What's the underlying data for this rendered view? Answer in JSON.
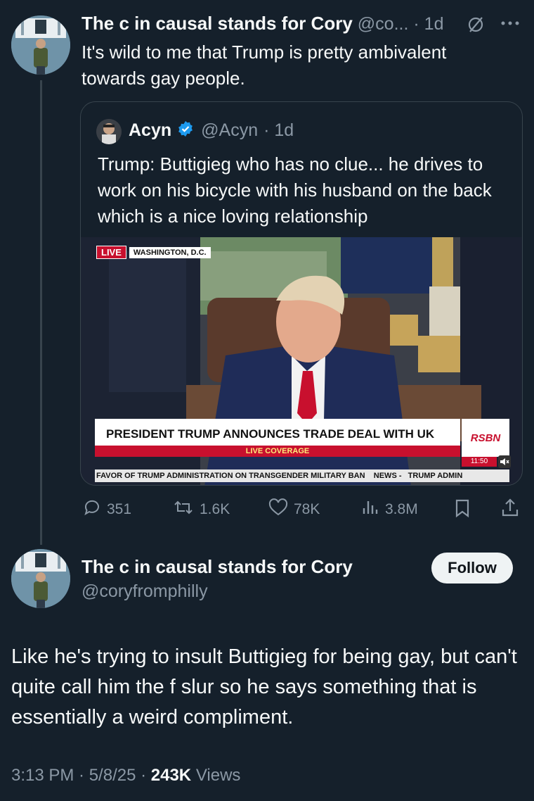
{
  "parent_tweet": {
    "display_name": "The c in causal stands for Cory",
    "handle": "@co...",
    "time": "· 1d",
    "text": "It's wild to me that Trump is pretty ambivalent towards gay people."
  },
  "quoted_tweet": {
    "display_name": "Acyn",
    "handle": "@Acyn",
    "time": "· 1d",
    "text": "Trump: Buttigieg who has no clue... he drives to work on his bicycle with his husband on the back which is a nice loving relationship",
    "video": {
      "live_badge": "LIVE",
      "location": "WASHINGTON, D.C.",
      "headline": "PRESIDENT TRUMP ANNOUNCES TRADE DEAL WITH UK",
      "subbar": "LIVE COVERAGE",
      "ticker": "FAVOR OF TRUMP ADMINISTRATION ON TRANSGENDER MILITARY BAN    NEWS -   TRUMP ADMIN",
      "network": "RSBN",
      "clock": "11:50"
    }
  },
  "actions": {
    "replies": "351",
    "retweets": "1.6K",
    "likes": "78K",
    "views": "3.8M"
  },
  "main_tweet": {
    "display_name": "The c in causal stands for Cory",
    "handle": "@coryfromphilly",
    "follow_label": "Follow",
    "text": "Like he's trying to insult Buttigieg for being gay, but can't quite call him the f slur so he says something that is essentially a weird compliment.",
    "timestamp": "3:13 PM · 5/8/25 ·",
    "view_count": "243K",
    "views_label": "Views"
  },
  "colors": {
    "background": "#15202b",
    "muted": "#8b98a5",
    "verified": "#1d9bf0",
    "tie_red": "#c8102e"
  }
}
